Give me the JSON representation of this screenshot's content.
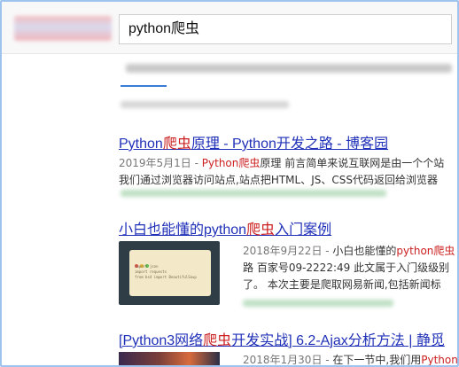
{
  "search": {
    "query": "python爬虫"
  },
  "results": [
    {
      "title_pre": "Python",
      "title_hl": "爬虫",
      "title_post": "原理 - Python开发之路 - 博客园",
      "line1_date": "2019年5月1日 - ",
      "line1_pre": "Python",
      "line1_hl": "爬虫",
      "line1_post": "原理 前言简单来说互联网是由一个个站",
      "line2": "我们通过浏览器访问站点,站点把HTML、JS、CSS代码返回给浏览器"
    },
    {
      "title_pre": "小白也能懂的python",
      "title_hl": "爬虫",
      "title_post": "入门案例",
      "line1_date": "2018年9月22日 - ",
      "line1_pre": "小白也能懂的",
      "line1_hl": "python爬虫",
      "line1_post": "",
      "line2": "路 百家号09-2222:49 此文属于入门级级别",
      "line3": "了。 本次主要是爬取网易新闻,包括新闻标"
    },
    {
      "title_pre": "[Python3网络",
      "title_hl": "爬虫",
      "title_post": "开发实战] 6.2-Ajax分析方法 | 静觅",
      "line1_date": "2018年1月30日 - ",
      "line1_pre": "在下一节中,我们用",
      "line1_hl": "Python",
      "line1_post": ""
    }
  ],
  "thumbnail_code": "import json\nimport requests\nfrom bs4 import BeautifulSoup"
}
